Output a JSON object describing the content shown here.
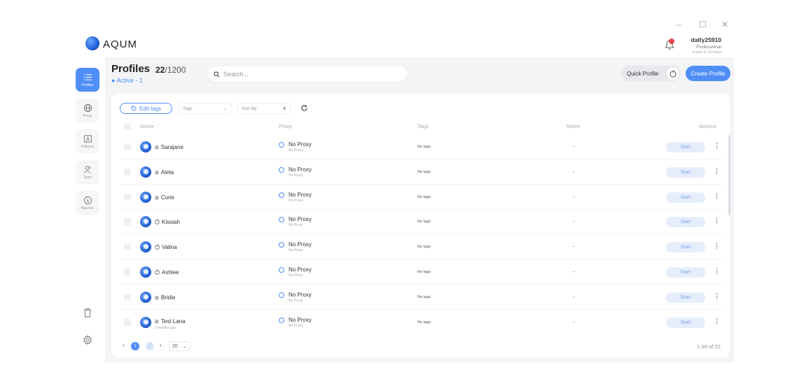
{
  "window": {
    "minimize": "–",
    "maximize": "☐",
    "close": "✕"
  },
  "app": {
    "brand": "AQUM"
  },
  "user": {
    "name": "datly25910",
    "plan": "Professional",
    "expires": "Expire in 110 days"
  },
  "sidebar": {
    "items": [
      {
        "label": "Profiles",
        "icon": "list-icon",
        "active": true
      },
      {
        "label": "Proxy",
        "icon": "globe-icon",
        "active": false
      },
      {
        "label": "Patterns",
        "icon": "pattern-icon",
        "active": false
      },
      {
        "label": "Team",
        "icon": "team-icon",
        "active": false
      },
      {
        "label": "Balance",
        "icon": "dollar-icon",
        "active": false
      }
    ]
  },
  "header": {
    "title": "Profiles",
    "count_used": "22",
    "count_total": "/1200",
    "active": "● Active - 1",
    "search_placeholder": "Search...",
    "quick_profile": "Quick Profile",
    "create_profile": "Create Profile"
  },
  "toolbar": {
    "edit_tags": "Edit tags",
    "tags_placeholder": "Tags",
    "sort_placeholder": "Sort By",
    "sort_clear": "x"
  },
  "table": {
    "columns": {
      "name": "Name",
      "proxy": "Proxy",
      "tags": "Tags",
      "notes": "Notes",
      "actions": "Actions"
    },
    "rows": [
      {
        "os": "⊞",
        "name": "Sarajane",
        "sub": "",
        "proxy": "No Proxy",
        "proxy_sub": "No Proxy",
        "tags": "No tags",
        "notes": "–",
        "action": "Start"
      },
      {
        "os": "⊞",
        "name": "Aleta",
        "sub": "",
        "proxy": "No Proxy",
        "proxy_sub": "No Proxy",
        "tags": "No tags",
        "notes": "–",
        "action": "Start"
      },
      {
        "os": "⊞",
        "name": "Corie",
        "sub": "",
        "proxy": "No Proxy",
        "proxy_sub": "No Proxy",
        "tags": "No tags",
        "notes": "–",
        "action": "Start"
      },
      {
        "os": "",
        "name": "Kissiah",
        "sub": "",
        "proxy": "No Proxy",
        "proxy_sub": "No Proxy",
        "tags": "No tags",
        "notes": "–",
        "action": "Start"
      },
      {
        "os": "",
        "name": "Valina",
        "sub": "",
        "proxy": "No Proxy",
        "proxy_sub": "No Proxy",
        "tags": "No tags",
        "notes": "–",
        "action": "Start"
      },
      {
        "os": "",
        "name": "Ashlee",
        "sub": "",
        "proxy": "No Proxy",
        "proxy_sub": "No Proxy",
        "tags": "No tags",
        "notes": "–",
        "action": "Start"
      },
      {
        "os": "⊞",
        "name": "Bridie",
        "sub": "",
        "proxy": "No Proxy",
        "proxy_sub": "No Proxy",
        "tags": "No tags",
        "notes": "–",
        "action": "Start"
      },
      {
        "os": "⊞",
        "name": "Test Lana",
        "sub": "2 months ago",
        "proxy": "No Proxy",
        "proxy_sub": "No Proxy",
        "tags": "No tags",
        "notes": "–",
        "action": "Start"
      }
    ]
  },
  "pagination": {
    "prev": "‹",
    "current": "1",
    "page2": "2",
    "next": "›",
    "page_size": "20",
    "total": "1-20 of 22"
  }
}
